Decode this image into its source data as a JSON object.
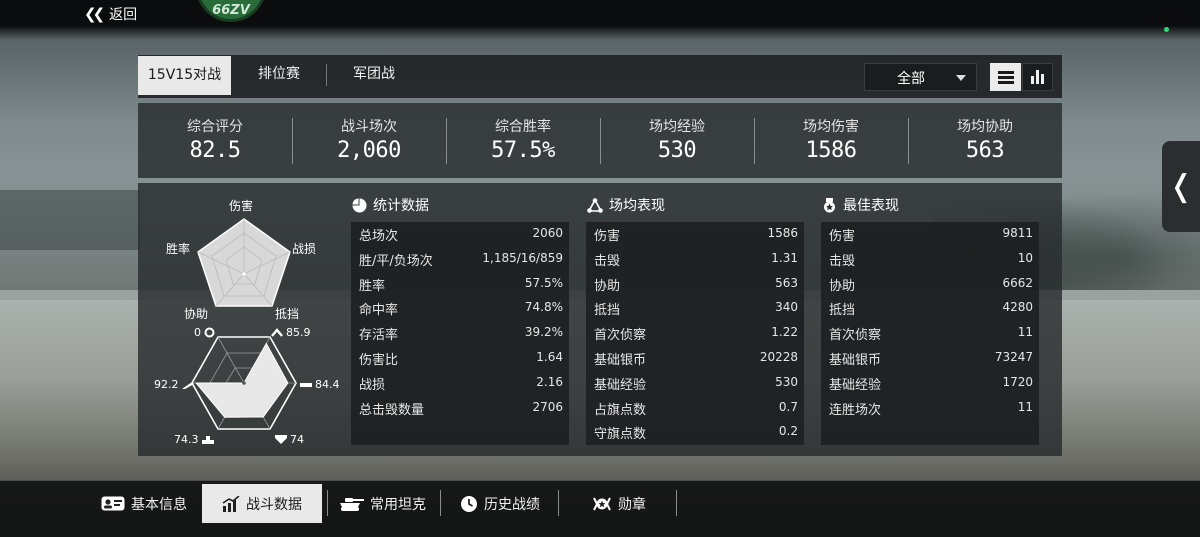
{
  "nav": {
    "back_label": "返回",
    "badge_text": "66ZV"
  },
  "tabs": [
    {
      "label": "15V15对战",
      "active": true
    },
    {
      "label": "排位赛",
      "active": false
    },
    {
      "label": "军团战",
      "active": false
    }
  ],
  "filter": {
    "selected": "全部",
    "icon": "chevron-down-icon"
  },
  "view_toggle": {
    "list_icon": "list-view-icon",
    "chart_icon": "bar-chart-icon",
    "active": "list"
  },
  "summary": [
    {
      "label": "综合评分",
      "value": "82.5"
    },
    {
      "label": "战斗场次",
      "value": "2,060"
    },
    {
      "label": "综合胜率",
      "value": "57.5%"
    },
    {
      "label": "场均经验",
      "value": "530"
    },
    {
      "label": "场均伤害",
      "value": "1586"
    },
    {
      "label": "场均协助",
      "value": "563"
    }
  ],
  "radar_top": {
    "labels": {
      "top": "伤害",
      "left": "胜率",
      "right": "战损",
      "bottom_left": "协助",
      "bottom_right": "抵挡"
    }
  },
  "radar_bottom": {
    "values": {
      "top_left": "0",
      "top_right": "85.9",
      "right": "84.4",
      "bottom_right": "74",
      "bottom_left": "74.3",
      "left": "92.2"
    },
    "fractions": [
      0.859,
      0.844,
      0.74,
      0.743,
      0.922,
      0.0
    ]
  },
  "stats": {
    "title": "统计数据",
    "rows": [
      {
        "k": "总场次",
        "v": "2060"
      },
      {
        "k": "胜/平/负场次",
        "v": "1,185/16/859"
      },
      {
        "k": "胜率",
        "v": "57.5%"
      },
      {
        "k": "命中率",
        "v": "74.8%"
      },
      {
        "k": "存活率",
        "v": "39.2%"
      },
      {
        "k": "伤害比",
        "v": "1.64"
      },
      {
        "k": "战损",
        "v": "2.16"
      },
      {
        "k": "总击毁数量",
        "v": "2706"
      }
    ]
  },
  "average": {
    "title": "场均表现",
    "rows": [
      {
        "k": "伤害",
        "v": "1586"
      },
      {
        "k": "击毁",
        "v": "1.31"
      },
      {
        "k": "协助",
        "v": "563"
      },
      {
        "k": "抵挡",
        "v": "340"
      },
      {
        "k": "首次侦察",
        "v": "1.22"
      },
      {
        "k": "基础银币",
        "v": "20228"
      },
      {
        "k": "基础经验",
        "v": "530"
      },
      {
        "k": "占旗点数",
        "v": "0.7"
      },
      {
        "k": "守旗点数",
        "v": "0.2"
      }
    ]
  },
  "best": {
    "title": "最佳表现",
    "rows": [
      {
        "k": "伤害",
        "v": "9811"
      },
      {
        "k": "击毁",
        "v": "10"
      },
      {
        "k": "协助",
        "v": "6662"
      },
      {
        "k": "抵挡",
        "v": "4280"
      },
      {
        "k": "首次侦察",
        "v": "11"
      },
      {
        "k": "基础银币",
        "v": "73247"
      },
      {
        "k": "基础经验",
        "v": "1720"
      },
      {
        "k": "连胜场次",
        "v": "11"
      }
    ]
  },
  "bottom_tabs": [
    {
      "label": "基本信息",
      "icon": "id-card-icon",
      "active": false
    },
    {
      "label": "战斗数据",
      "icon": "stats-chart-icon",
      "active": true
    },
    {
      "label": "常用坦克",
      "icon": "tank-icon",
      "active": false
    },
    {
      "label": "历史战绩",
      "icon": "history-clock-icon",
      "active": false
    },
    {
      "label": "勋章",
      "icon": "medal-icon",
      "active": false
    }
  ],
  "colors": {
    "accent_bg": "#e9e9e9",
    "panel": "#2a2e30",
    "badge_green": "#2a6b3a"
  }
}
